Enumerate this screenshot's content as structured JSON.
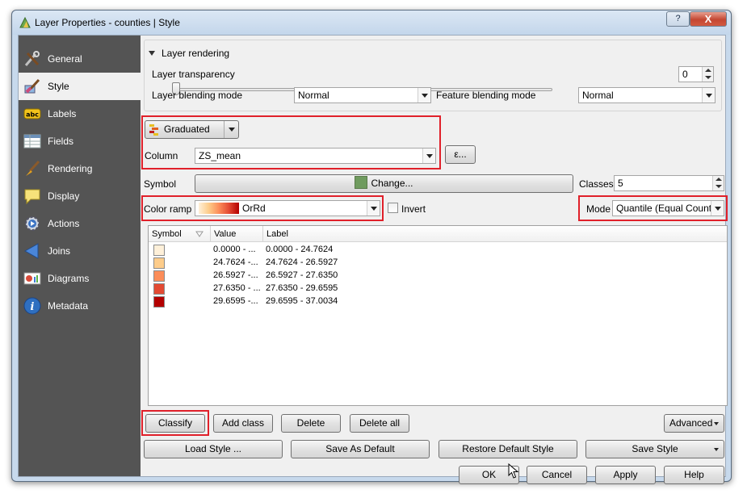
{
  "window": {
    "title": "Layer Properties - counties | Style",
    "help_label": "?",
    "close_label": "X"
  },
  "sidebar": {
    "items": [
      {
        "label": "General",
        "icon": "tools-icon"
      },
      {
        "label": "Style",
        "icon": "style-brush-icon"
      },
      {
        "label": "Labels",
        "icon": "abc-labels-icon"
      },
      {
        "label": "Fields",
        "icon": "table-fields-icon"
      },
      {
        "label": "Rendering",
        "icon": "paintbrush-icon"
      },
      {
        "label": "Display",
        "icon": "speech-bubble-icon"
      },
      {
        "label": "Actions",
        "icon": "gear-play-icon"
      },
      {
        "label": "Joins",
        "icon": "join-arrow-icon"
      },
      {
        "label": "Diagrams",
        "icon": "diagram-icon"
      },
      {
        "label": "Metadata",
        "icon": "info-icon"
      }
    ],
    "active": "Style"
  },
  "layer_rendering": {
    "group_title": "Layer rendering",
    "transparency_label": "Layer transparency",
    "transparency_value": "0",
    "blending_label": "Layer blending mode",
    "blending_value": "Normal",
    "feature_blending_label": "Feature blending mode",
    "feature_blending_value": "Normal"
  },
  "renderer": {
    "type_value": "Graduated",
    "column_label": "Column",
    "column_value": "ZS_mean",
    "expr_button": "ε..."
  },
  "symbol": {
    "label": "Symbol",
    "change_button": "Change...",
    "swatch_color": "#6f9b5e",
    "classes_label": "Classes",
    "classes_value": "5"
  },
  "color_ramp": {
    "label": "Color ramp",
    "value": "OrRd",
    "invert_label": "Invert",
    "mode_label": "Mode",
    "mode_value": "Quantile (Equal Count)"
  },
  "table": {
    "headers": [
      "Symbol",
      "Value",
      "Label"
    ],
    "rows": [
      {
        "color": "#fef0d9",
        "value": "0.0000 - ...",
        "label": "0.0000 - 24.7624"
      },
      {
        "color": "#fdcc8a",
        "value": "24.7624 -...",
        "label": "24.7624 - 26.5927"
      },
      {
        "color": "#fc8d59",
        "value": "26.5927 -...",
        "label": "26.5927 - 27.6350"
      },
      {
        "color": "#e34a33",
        "value": "27.6350 - ...",
        "label": "27.6350 - 29.6595"
      },
      {
        "color": "#b30000",
        "value": "29.6595 -...",
        "label": "29.6595 - 37.0034"
      }
    ]
  },
  "buttons": {
    "classify": "Classify",
    "add_class": "Add class",
    "delete": "Delete",
    "delete_all": "Delete all",
    "advanced": "Advanced",
    "load_style": "Load Style ...",
    "save_default": "Save As Default",
    "restore_default": "Restore Default Style",
    "save_style": "Save Style",
    "ok": "OK",
    "cancel": "Cancel",
    "apply": "Apply",
    "help": "Help"
  },
  "colors": {
    "highlight": "#e0202a",
    "sidebar_bg": "#545454"
  }
}
